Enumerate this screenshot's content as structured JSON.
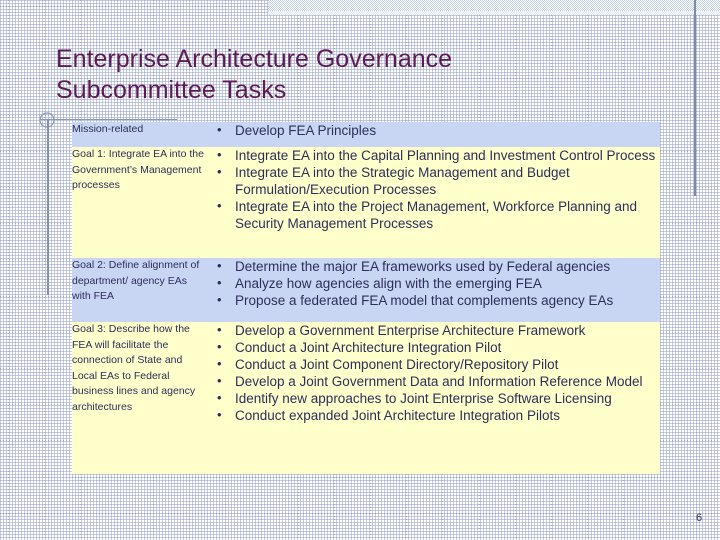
{
  "slide": {
    "title": "Enterprise Architecture Governance\nSubcommittee Tasks",
    "page_number": "6",
    "colors": {
      "title_text": "#5d1a55",
      "body_text": "#2d2d59",
      "row_blue": "#c8d6f4",
      "row_yellow": "#ffffcc",
      "rule": "#8390ad",
      "band": "#c9d6ef"
    }
  },
  "table": {
    "rows": [
      {
        "label": "Mission-related",
        "shade": "blue",
        "bullets": [
          "Develop FEA Principles"
        ]
      },
      {
        "label": "Goal 1: Integrate EA into the Government’s Management processes",
        "shade": "yellow",
        "bullets": [
          "Integrate EA into the Capital Planning and Investment Control Process",
          "Integrate EA into the Strategic Management and Budget Formulation/Execution Processes",
          "Integrate EA into the Project Management, Workforce Planning and Security Management Processes"
        ]
      },
      {
        "label": "Goal 2: Define alignment of department/ agency EAs with FEA",
        "shade": "blue",
        "bullets": [
          "Determine the major EA frameworks used by Federal agencies",
          "Analyze how agencies align with the emerging FEA",
          "Propose a federated FEA model that complements agency EAs"
        ]
      },
      {
        "label": "Goal 3: Describe how the FEA will facilitate the connection of State and Local EAs to Federal business lines and agency architectures",
        "shade": "yellow",
        "bullets": [
          "Develop a Government Enterprise Architecture Framework",
          "Conduct a Joint Architecture Integration Pilot",
          "Conduct a Joint Component Directory/Repository Pilot",
          "Develop a Joint Government Data and Information Reference Model",
          "Identify new approaches to Joint Enterprise Software Licensing",
          "Conduct expanded Joint Architecture Integration Pilots"
        ]
      }
    ]
  }
}
